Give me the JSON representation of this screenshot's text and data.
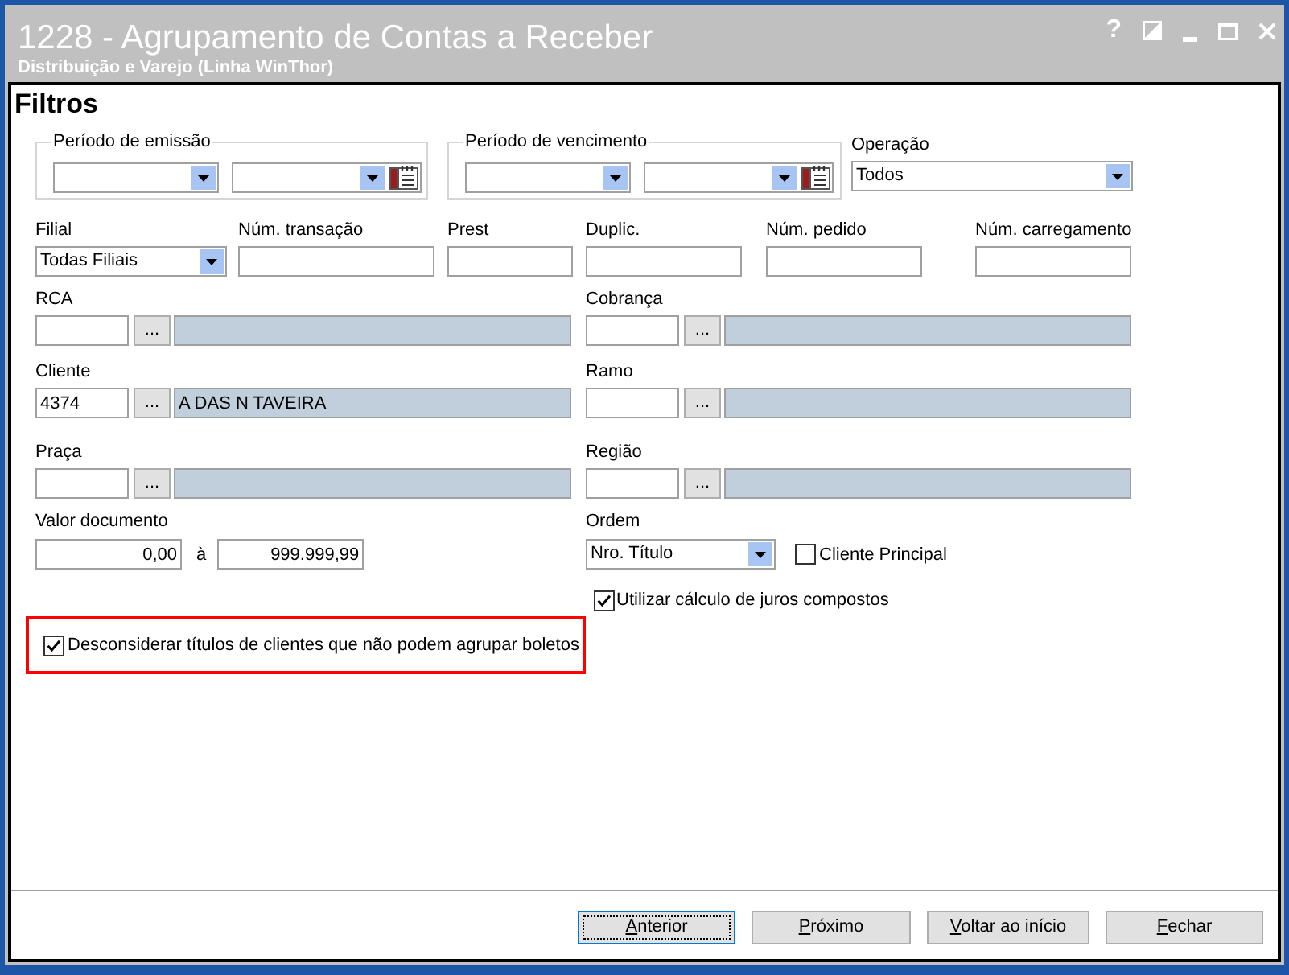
{
  "window": {
    "title": "1228 - Agrupamento de Contas a Receber",
    "subtitle": "Distribuição e Varejo (Linha WinThor)",
    "help": "?"
  },
  "section_title": "Filtros",
  "date_ranges": [
    {
      "label": "Período de emissão"
    },
    {
      "label": "Período de vencimento"
    }
  ],
  "operation": {
    "label": "Operação",
    "value": "Todos"
  },
  "fields": [
    {
      "kind": "combo",
      "label": "Filial",
      "value": "Todas Filiais"
    },
    {
      "kind": "text",
      "label": "Núm. transação"
    },
    {
      "kind": "text",
      "label": "Prest"
    },
    {
      "kind": "text",
      "label": "Duplic."
    },
    {
      "kind": "text",
      "label": "Núm. pedido"
    },
    {
      "kind": "text",
      "label": "Núm. carregamento"
    }
  ],
  "lookups": [
    {
      "label": "RCA",
      "button": "..."
    },
    {
      "label": "Cobrança",
      "button": "..."
    },
    {
      "label": "Cliente",
      "code": "4374",
      "button": "...",
      "description": "A DAS N TAVEIRA"
    },
    {
      "label": "Ramo",
      "button": "..."
    },
    {
      "label": "Praça",
      "button": "..."
    },
    {
      "label": "Região",
      "button": "..."
    }
  ],
  "document_value": {
    "label": "Valor documento",
    "from": "0,00",
    "separator": "à",
    "to": "999.999,99"
  },
  "order": {
    "label": "Ordem",
    "value": "Nro. Título",
    "checkbox": {
      "label": "Cliente Principal",
      "checked": false
    }
  },
  "options": [
    {
      "label": "Utilizar cálculo de juros compostos",
      "checked": true,
      "highlighted": false
    },
    {
      "label": "Desconsiderar títulos de clientes que não podem agrupar boletos",
      "checked": true,
      "highlighted": true
    }
  ],
  "buttons": [
    {
      "label": "Anterior",
      "focused": true
    },
    {
      "label": "Próximo",
      "focused": false
    },
    {
      "label": "Voltar ao início",
      "focused": false
    },
    {
      "label": "Fechar",
      "focused": false
    }
  ]
}
